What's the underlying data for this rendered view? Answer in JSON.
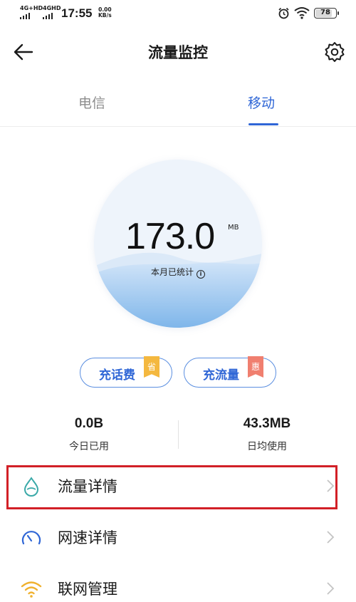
{
  "status_bar": {
    "network_1": "4G+HD",
    "network_2": "4GHD",
    "time": "17:55",
    "speed_value": "0.00",
    "speed_unit": "KB/s",
    "battery": "78",
    "icons": [
      "alarm-icon",
      "wifi-icon",
      "battery-icon"
    ]
  },
  "header": {
    "title": "流量监控",
    "back_icon": "back-arrow-icon",
    "settings_icon": "gear-icon"
  },
  "tabs": [
    {
      "label": "电信",
      "active": false
    },
    {
      "label": "移动",
      "active": true
    }
  ],
  "usage": {
    "value": "173.0",
    "unit": "MB",
    "caption": "本月已统计",
    "info_icon": "info-icon"
  },
  "actions": [
    {
      "label": "充话费",
      "badge": "省",
      "badge_color": "#f4b83f"
    },
    {
      "label": "充流量",
      "badge": "惠",
      "badge_color": "#f07f6f"
    }
  ],
  "stats": [
    {
      "value": "0.0B",
      "label": "今日已用"
    },
    {
      "value": "43.3MB",
      "label": "日均使用"
    }
  ],
  "menu": [
    {
      "label": "流量详情",
      "icon": "water-drop-icon",
      "highlighted": true
    },
    {
      "label": "网速详情",
      "icon": "speedometer-icon",
      "highlighted": false
    },
    {
      "label": "联网管理",
      "icon": "wifi-icon",
      "highlighted": false
    }
  ],
  "colors": {
    "accent": "#2f66d6",
    "highlight_box": "#d22027",
    "wave_blue": "#a9cdf2"
  }
}
